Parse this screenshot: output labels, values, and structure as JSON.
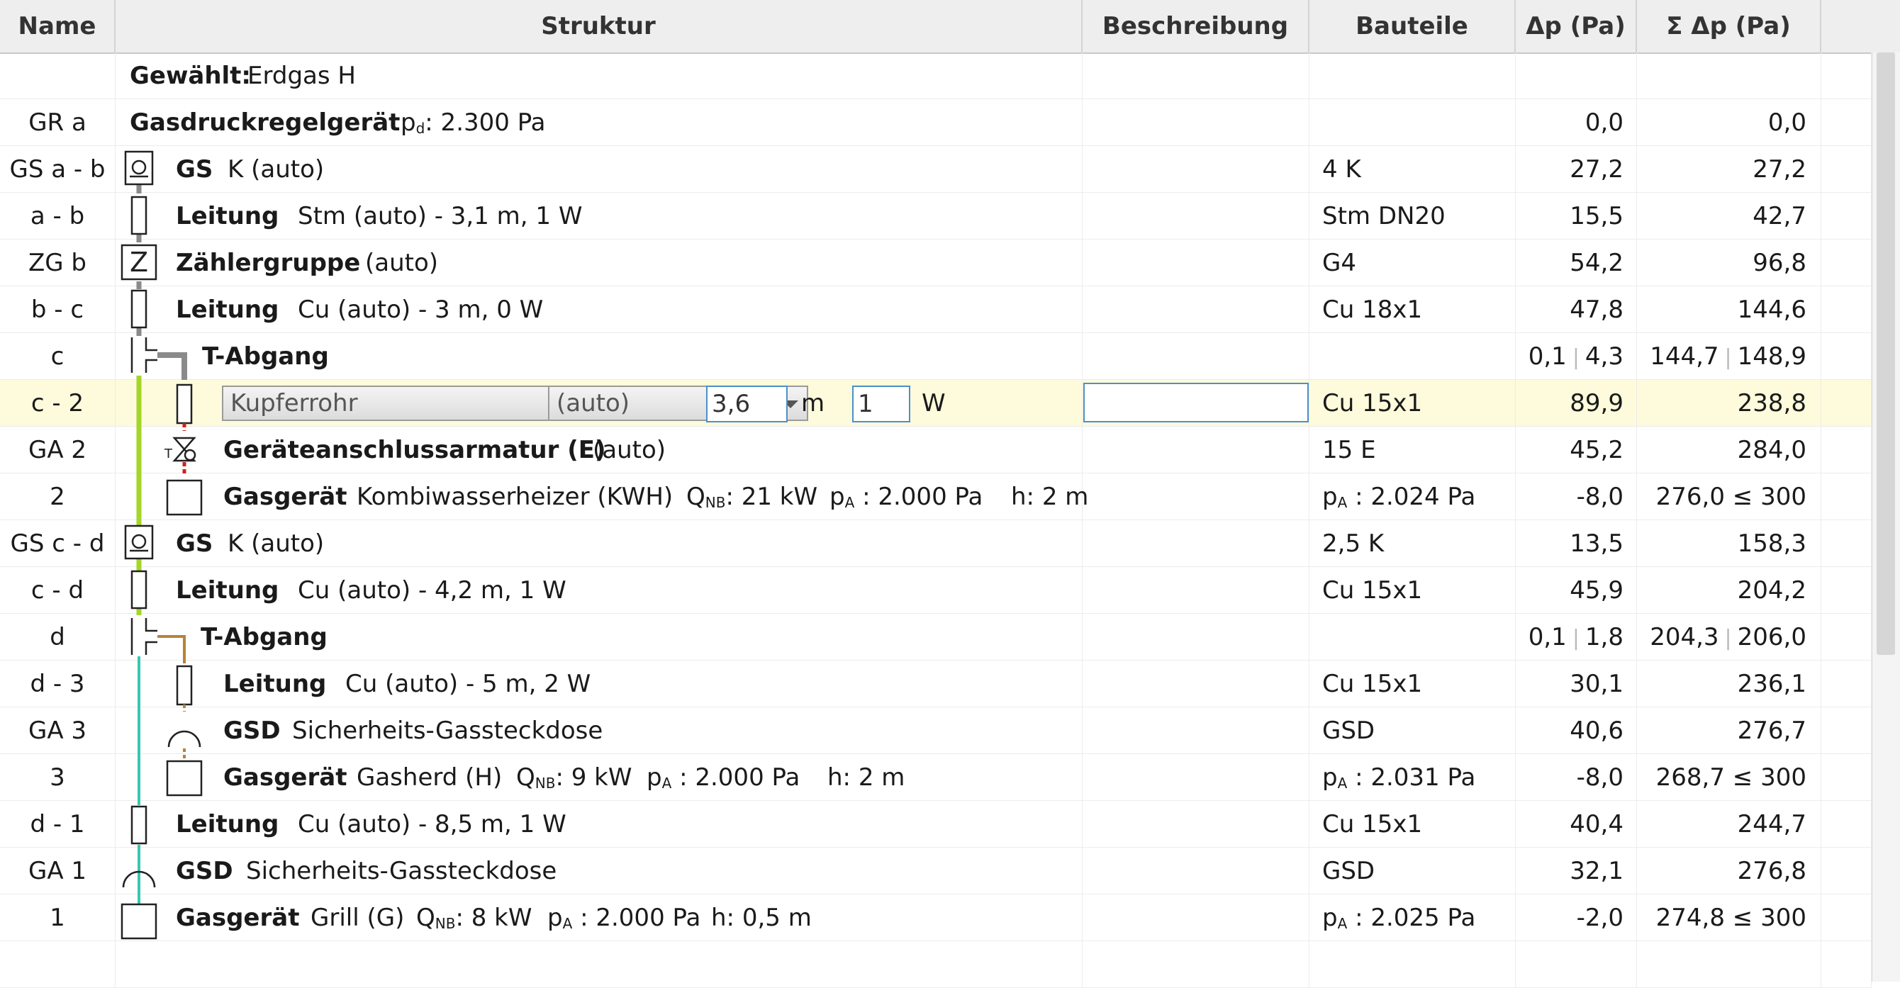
{
  "columns": {
    "name": "Name",
    "struktur": "Struktur",
    "beschreibung": "Beschreibung",
    "bauteile": "Bauteile",
    "dp": "Δp (Pa)",
    "sdp": "Σ Δp (Pa)"
  },
  "rows": [
    {
      "name": "",
      "label": "Gewählt:",
      "text": "Erdgas H",
      "bauteile": "",
      "dp": "",
      "sdp": ""
    },
    {
      "name": "GR a",
      "label": "Gasdruckregelgerät",
      "text": "p",
      "sub": "d",
      "text2": ": 2.300 Pa",
      "bauteile": "",
      "dp": "0,0",
      "sdp": "0,0"
    },
    {
      "name": "GS a - b",
      "label": "GS",
      "text": "K (auto)",
      "bauteile": "4 K",
      "dp": "27,2",
      "sdp": "27,2"
    },
    {
      "name": "a - b",
      "label": "Leitung",
      "text": "Stm (auto) - 3,1 m, 1 W",
      "bauteile": "Stm DN20",
      "dp": "15,5",
      "sdp": "42,7"
    },
    {
      "name": "ZG b",
      "label": "Zählergruppe",
      "text": "(auto)",
      "bauteile": "G4",
      "dp": "54,2",
      "sdp": "96,8"
    },
    {
      "name": "b - c",
      "label": "Leitung",
      "text": "Cu (auto) - 3 m, 0 W",
      "bauteile": "Cu 18x1",
      "dp": "47,8",
      "sdp": "144,6"
    },
    {
      "name": "c",
      "label": "T-Abgang",
      "text": "",
      "bauteile": "",
      "dp_a": "0,1",
      "dp_b": "4,3",
      "sdp_a": "144,7",
      "sdp_b": "148,9"
    },
    {
      "name": "c - 2",
      "editor": {
        "material": "Kupferrohr",
        "dim": "(auto)",
        "length": "3,6",
        "length_unit": "m",
        "count": "1",
        "count_unit": "W"
      },
      "bauteile": "Cu 15x1",
      "dp": "89,9",
      "sdp": "238,8"
    },
    {
      "name": "GA 2",
      "label": "Geräteanschlussarmatur (E)",
      "text": "(auto)",
      "bauteile": "15 E",
      "dp": "45,2",
      "sdp": "284,0"
    },
    {
      "name": "2",
      "label": "Gasgerät",
      "text": "Kombiwasserheizer (KWH)",
      "q": "21 kW",
      "pa": "2.000 Pa",
      "h": "2 m",
      "bauteile_pre": "p",
      "bauteile_sub": "A",
      "bauteile": " : 2.024 Pa",
      "dp": "-8,0",
      "sdp": "276,0 ≤ 300"
    },
    {
      "name": "GS c - d",
      "label": "GS",
      "text": "K (auto)",
      "bauteile": "2,5 K",
      "dp": "13,5",
      "sdp": "158,3"
    },
    {
      "name": "c - d",
      "label": "Leitung",
      "text": "Cu (auto) - 4,2 m, 1 W",
      "bauteile": "Cu 15x1",
      "dp": "45,9",
      "sdp": "204,2"
    },
    {
      "name": "d",
      "label": "T-Abgang",
      "text": "",
      "bauteile": "",
      "dp_a": "0,1",
      "dp_b": "1,8",
      "sdp_a": "204,3",
      "sdp_b": "206,0"
    },
    {
      "name": "d - 3",
      "label": "Leitung",
      "text": "Cu (auto) - 5 m, 2 W",
      "bauteile": "Cu 15x1",
      "dp": "30,1",
      "sdp": "236,1"
    },
    {
      "name": "GA 3",
      "label": "GSD",
      "text": "Sicherheits-Gassteckdose",
      "bauteile": "GSD",
      "dp": "40,6",
      "sdp": "276,7"
    },
    {
      "name": "3",
      "label": "Gasgerät",
      "text": "Gasherd (H)",
      "q": "9 kW",
      "pa": "2.000 Pa",
      "h": "2 m",
      "bauteile_pre": "p",
      "bauteile_sub": "A",
      "bauteile": " : 2.031 Pa",
      "dp": "-8,0",
      "sdp": "268,7 ≤ 300"
    },
    {
      "name": "d - 1",
      "label": "Leitung",
      "text": "Cu (auto) - 8,5 m, 1 W",
      "bauteile": "Cu 15x1",
      "dp": "40,4",
      "sdp": "244,7"
    },
    {
      "name": "GA 1",
      "label": "GSD",
      "text": "Sicherheits-Gassteckdose",
      "bauteile": "GSD",
      "dp": "32,1",
      "sdp": "276,8"
    },
    {
      "name": "1",
      "label": "Gasgerät",
      "text": "Grill (G)",
      "q": "8 kW",
      "pa": "2.000 Pa",
      "h": "0,5 m",
      "bauteile_pre": "p",
      "bauteile_sub": "A",
      "bauteile": " : 2.025 Pa",
      "dp": "-2,0",
      "sdp": "274,8 ≤ 300"
    }
  ],
  "labels": {
    "q": "Q",
    "q_sub": "NB",
    "pa": "p",
    "pa_sub": "A",
    "h": "h:"
  },
  "colors": {
    "branch_c2": "#a4d62a",
    "branch_d3": "#b8823a",
    "branch_d1": "#35c9b0",
    "main_pipe": "#8a8a8a",
    "valve_red": "#d02020",
    "selected_row": "#fdfbdc",
    "input_border": "#4a90c9"
  },
  "icons": {
    "gs": "gas-flow-monitor-icon",
    "zg": "meter-group-icon",
    "t": "tee-junction-icon",
    "ga": "appliance-valve-icon",
    "gsd": "gas-socket-icon",
    "device": "gas-appliance-icon",
    "pipe": "pipe-segment-icon"
  }
}
